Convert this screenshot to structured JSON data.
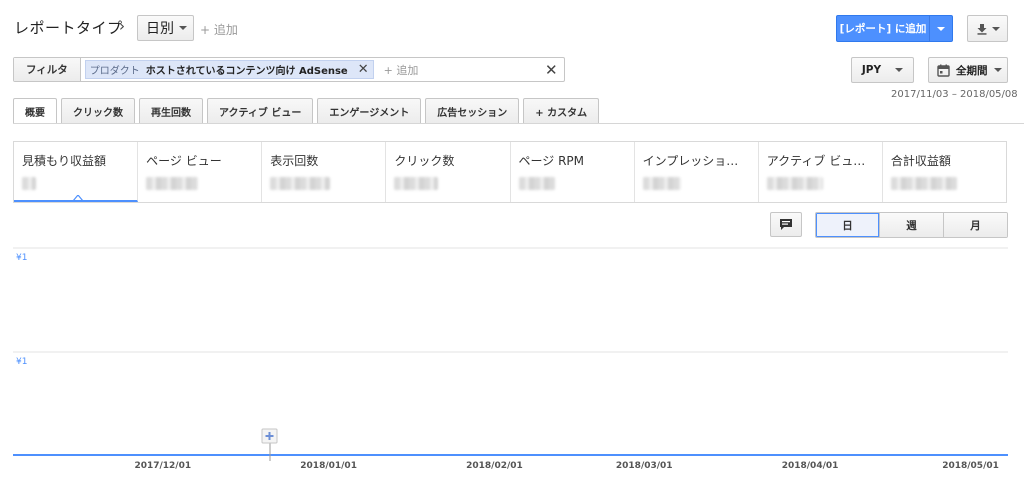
{
  "header": {
    "title": "レポートタイプ",
    "report_type": "日別",
    "add_label": "+ 追加",
    "add_report_label": "[レポート] に追加"
  },
  "filter": {
    "button_label": "フィルタ",
    "chip_key": "プロダクト",
    "chip_value": "ホストされているコンテンツ向け AdSense",
    "add_label": "+ 追加"
  },
  "controls": {
    "currency": "JPY",
    "period": "全期間",
    "date_range": "2017/11/03 – 2018/05/08"
  },
  "tabs": [
    {
      "label": "概要"
    },
    {
      "label": "クリック数"
    },
    {
      "label": "再生回数"
    },
    {
      "label": "アクティブ ビュー"
    },
    {
      "label": "エンゲージメント"
    },
    {
      "label": "広告セッション"
    },
    {
      "label": "+ カスタム"
    }
  ],
  "metrics": [
    {
      "label": "見積もり収益額"
    },
    {
      "label": "ページ ビュー"
    },
    {
      "label": "表示回数"
    },
    {
      "label": "クリック数"
    },
    {
      "label": "ページ RPM"
    },
    {
      "label": "インプレッション…"
    },
    {
      "label": "アクティブ ビュー…"
    },
    {
      "label": "合計収益額"
    }
  ],
  "granularity": [
    "日",
    "週",
    "月"
  ],
  "colors": {
    "accent": "#4d90fe"
  },
  "chart_data": {
    "type": "line",
    "y_ticks": [
      "¥1",
      "¥1"
    ],
    "x_ticks": [
      "2017/12/01",
      "2018/01/01",
      "2018/02/01",
      "2018/03/01",
      "2018/04/01",
      "2018/05/01"
    ],
    "x_range": [
      "2017/11/03",
      "2018/05/08"
    ],
    "series": [
      {
        "values": [
          0,
          0
        ]
      }
    ],
    "grid": true
  }
}
